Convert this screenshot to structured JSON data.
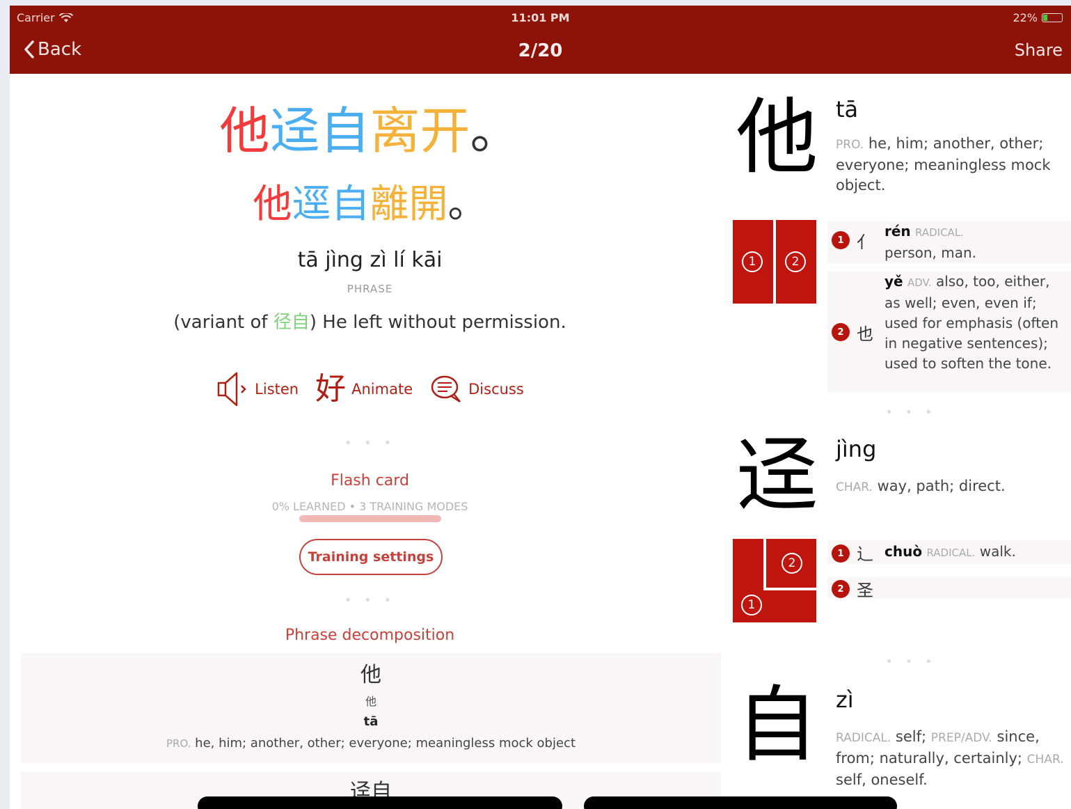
{
  "status": {
    "carrier": "Carrier",
    "time": "11:01 PM",
    "battery": "22%",
    "battery_level": 0.22
  },
  "nav": {
    "back_label": "Back",
    "title": "2/20",
    "share_label": "Share"
  },
  "phrase": {
    "simplified": [
      {
        "char": "他",
        "color": "#f23b3b"
      },
      {
        "char": "迳",
        "color": "#4aaef0"
      },
      {
        "char": "自",
        "color": "#4aaef0"
      },
      {
        "char": "离",
        "color": "#f5b23a"
      },
      {
        "char": "开",
        "color": "#f5b23a"
      },
      {
        "char": "。",
        "color": "#333333"
      }
    ],
    "traditional": [
      {
        "char": "他",
        "color": "#f23b3b"
      },
      {
        "char": "逕",
        "color": "#4aaef0"
      },
      {
        "char": "自",
        "color": "#4aaef0"
      },
      {
        "char": "離",
        "color": "#f5b23a"
      },
      {
        "char": "開",
        "color": "#f5b23a"
      },
      {
        "char": "。",
        "color": "#333333"
      }
    ],
    "pinyin": "tā jìng zì lí kāi",
    "pos": "PHRASE",
    "def_prefix": "(variant of ",
    "def_variant": "径自",
    "def_suffix": ") He left without permission."
  },
  "actions": {
    "listen": {
      "glyph": "🔈",
      "label": "Listen"
    },
    "animate": {
      "glyph": "好",
      "label": "Animate"
    },
    "discuss": {
      "glyph": "💬",
      "label": "Discuss"
    }
  },
  "flashcard": {
    "title": "Flash card",
    "subtitle": "0% LEARNED • 3 TRAINING MODES",
    "progress": 0.0,
    "training_button": "Training settings"
  },
  "decomposition": {
    "title": "Phrase decomposition",
    "items": [
      {
        "hanzi": "他",
        "small": "他",
        "pinyin": "tā",
        "pos": "PRO.",
        "def": "he, him; another, other; everyone; meaningless mock object"
      },
      {
        "hanzi": "迳自"
      }
    ]
  },
  "characters": [
    {
      "char": "他",
      "pinyin": "tā",
      "pos": "PRO.",
      "def": "he, him; another, other; everyone; meaningless mock object.",
      "components": [
        {
          "num": "1",
          "glyph": "亻",
          "pinyin": "rén",
          "pos": "RADICAL.",
          "def": "person, man."
        },
        {
          "num": "2",
          "glyph": "也",
          "pinyin": "yě",
          "pos": "ADV.",
          "def": "also, too, either, as well; even, even if; used for emphasis (often in negative sentences); used to soften the tone."
        }
      ]
    },
    {
      "char": "迳",
      "pinyin": "jìng",
      "pos": "CHAR.",
      "def": "way, path; direct.",
      "components": [
        {
          "num": "1",
          "glyph": "辶",
          "pinyin": "chuò",
          "pos": "RADICAL.",
          "def": "walk."
        },
        {
          "num": "2",
          "glyph": "圣"
        }
      ]
    },
    {
      "char": "自",
      "pinyin": "zì",
      "def_parts": [
        {
          "pos": "RADICAL.",
          "text": "self;"
        },
        {
          "pos": "PREP/ADV.",
          "text": "since, from; naturally, certainly;"
        },
        {
          "pos": "CHAR.",
          "text": "self, oneself."
        }
      ]
    }
  ],
  "separator": "• • •"
}
